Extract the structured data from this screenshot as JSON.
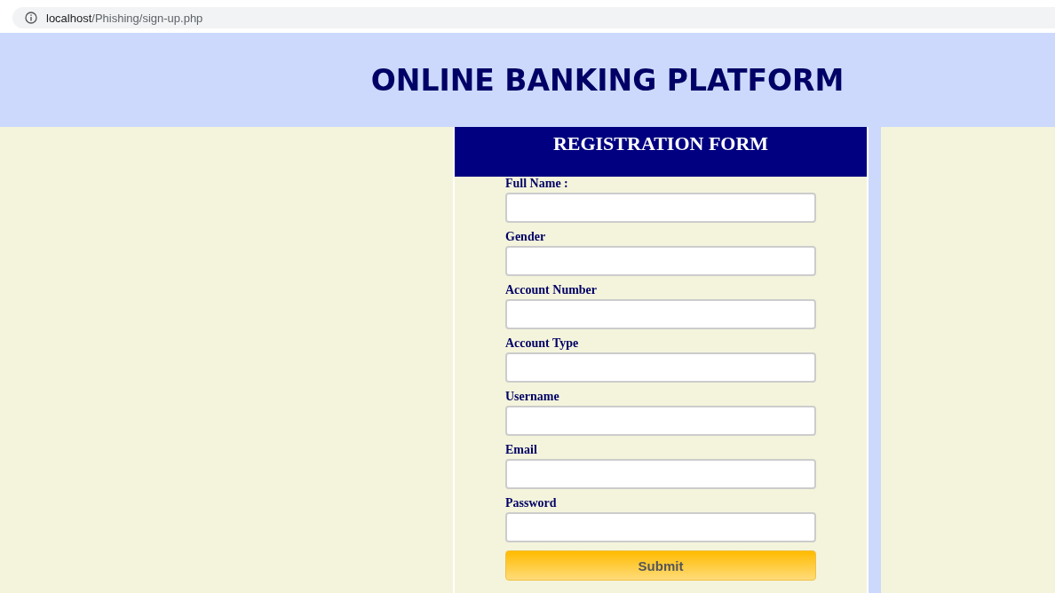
{
  "address_bar": {
    "host": "localhost",
    "path": "/Phishing/sign-up.php"
  },
  "header": {
    "title": "ONLINE BANKING PLATFORM"
  },
  "form": {
    "title": "REGISTRATION FORM",
    "fields": [
      {
        "label": "Full Name :"
      },
      {
        "label": "Gender"
      },
      {
        "label": "Account Number"
      },
      {
        "label": "Account Type"
      },
      {
        "label": "Username"
      },
      {
        "label": "Email"
      },
      {
        "label": "Password"
      }
    ],
    "submit": "Submit"
  }
}
